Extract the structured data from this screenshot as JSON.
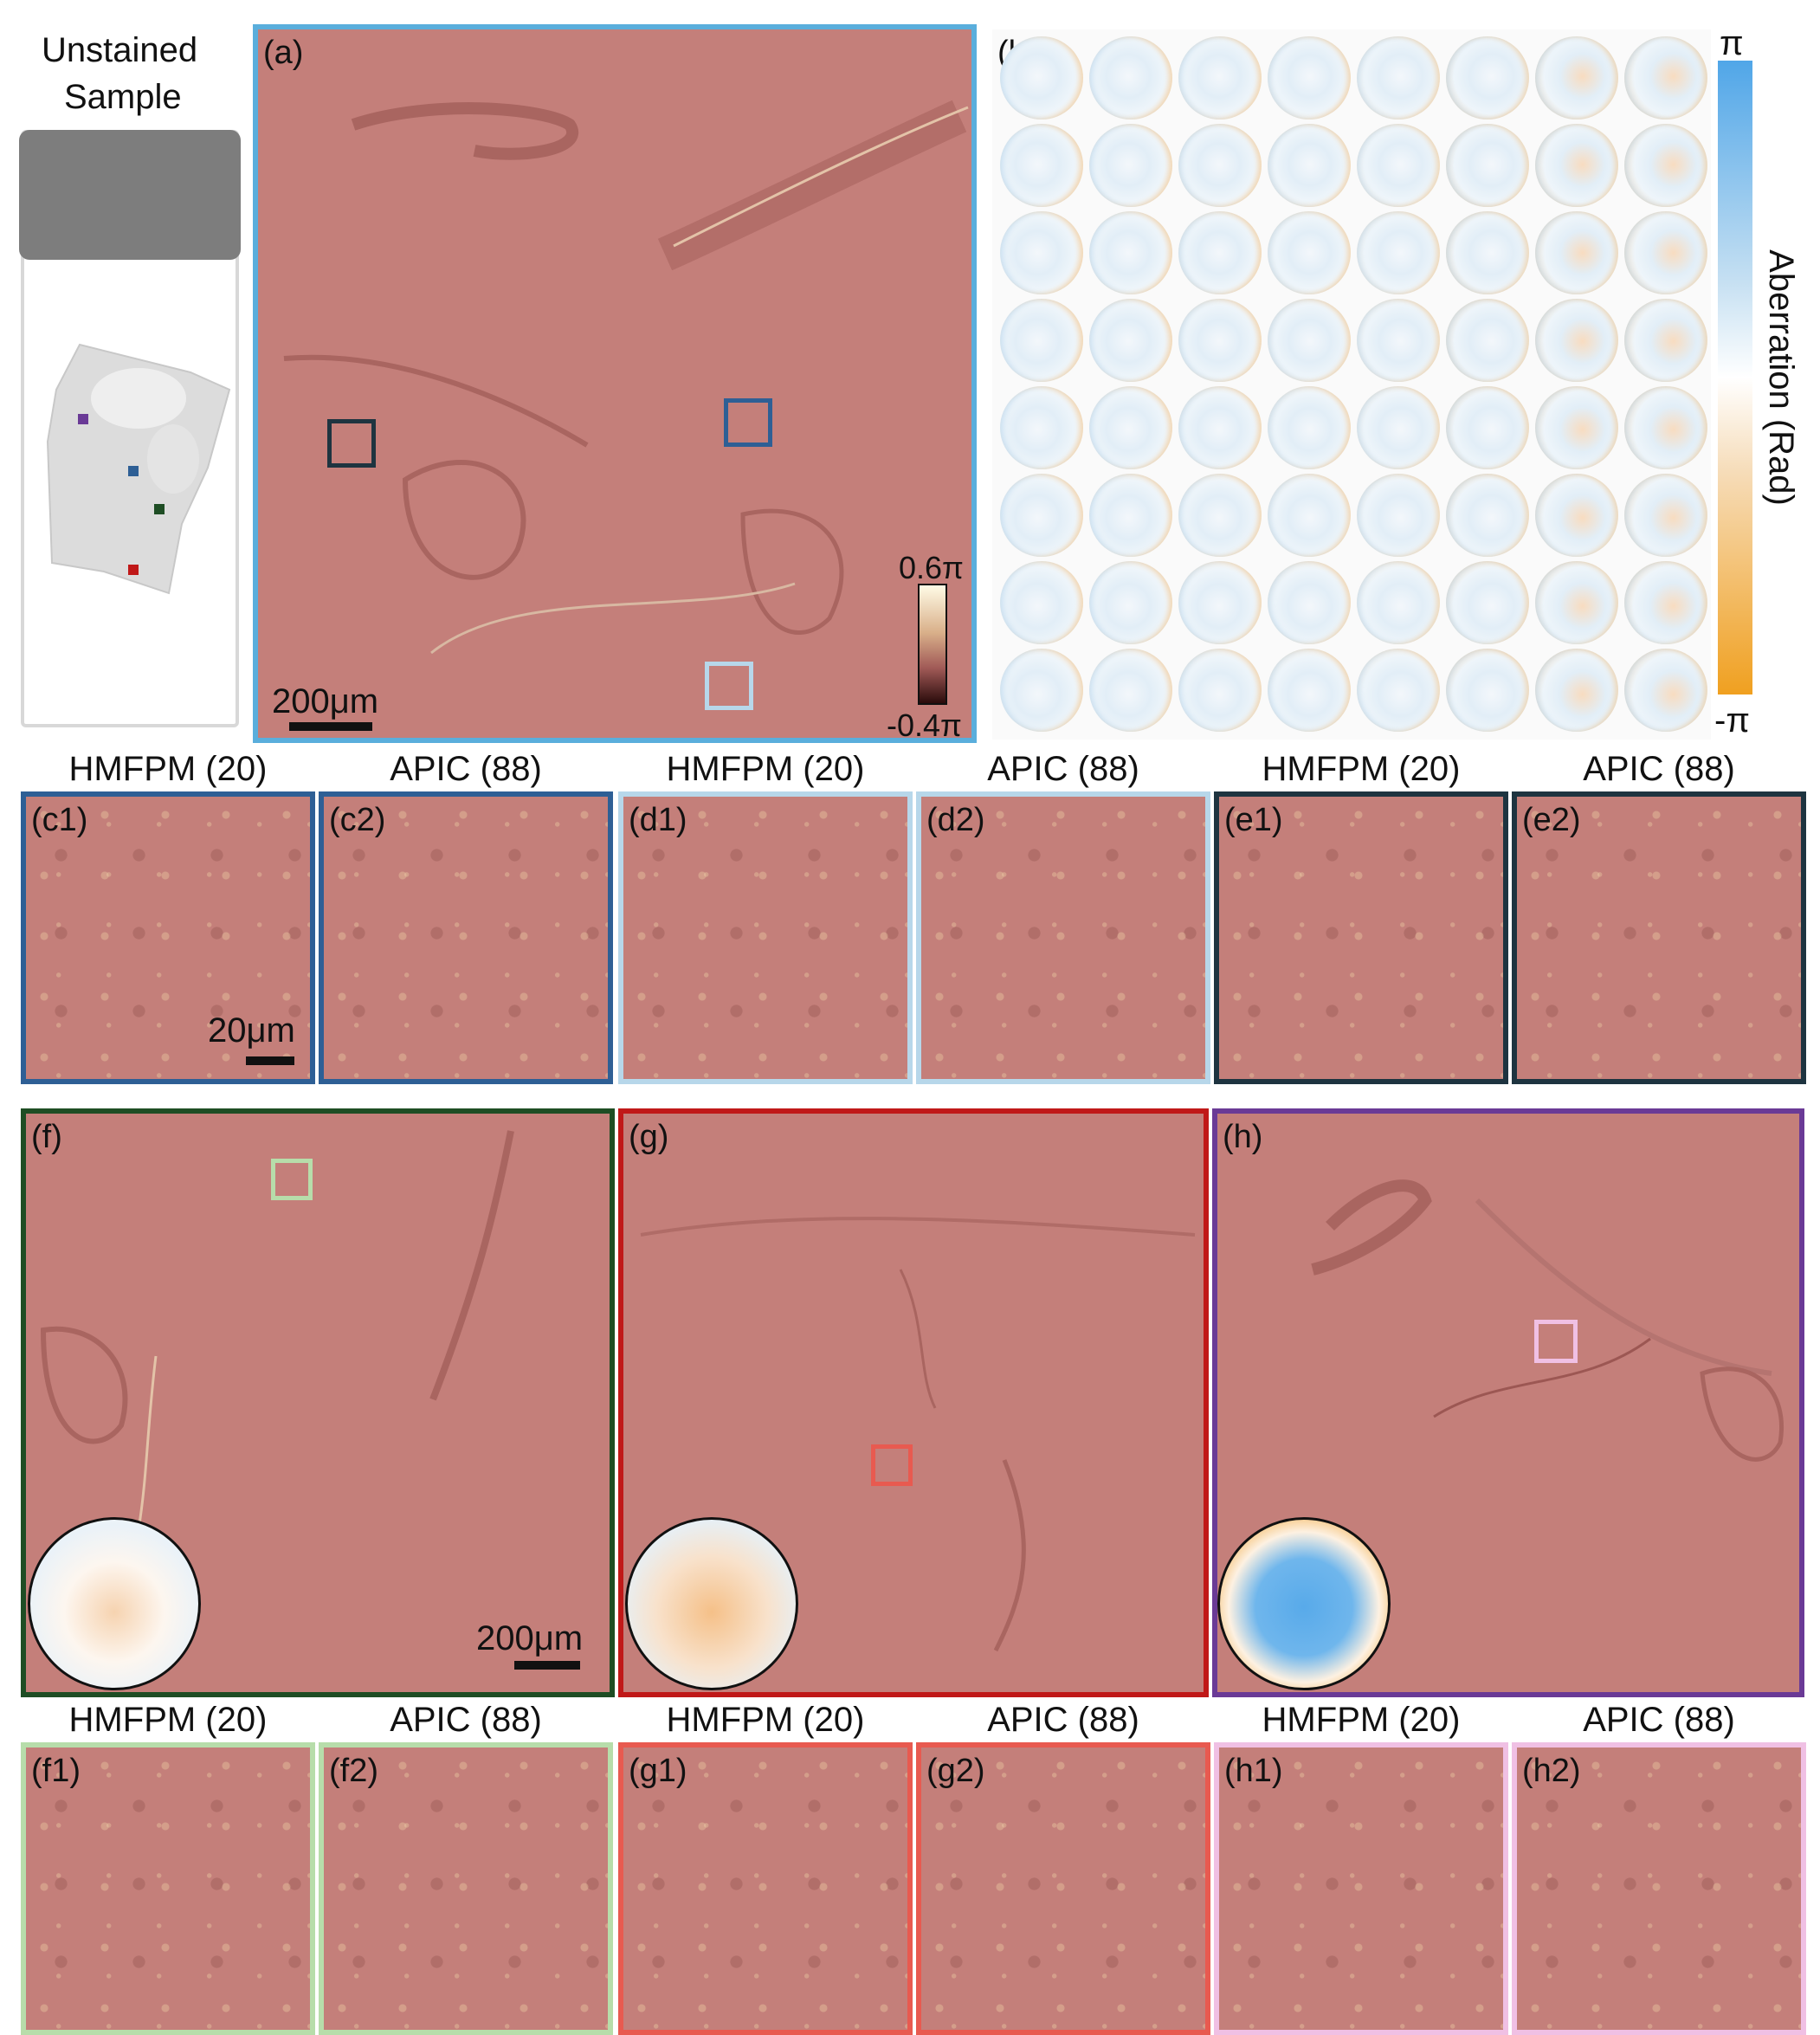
{
  "left_label": {
    "line1": "Unstained",
    "line2": "Sample"
  },
  "panel_a": {
    "label": "(a)",
    "scale": "200μm",
    "colorbar_max": "0.6π",
    "colorbar_min": "-0.4π"
  },
  "panel_b": {
    "label": "(b)",
    "cbar_top": "π",
    "cbar_bottom": "-π",
    "cbar_title": "Aberration (Rad)"
  },
  "row1_headers": [
    "HMFPM (20)",
    "APIC (88)",
    "HMFPM (20)",
    "APIC (88)",
    "HMFPM (20)",
    "APIC (88)"
  ],
  "row1_labels": [
    "(c1)",
    "(c2)",
    "(d1)",
    "(d2)",
    "(e1)",
    "(e2)"
  ],
  "row1_scale": "20μm",
  "panel_f": {
    "label": "(f)",
    "scale": "200μm"
  },
  "panel_g": {
    "label": "(g)"
  },
  "panel_h": {
    "label": "(h)"
  },
  "row2_headers": [
    "HMFPM (20)",
    "APIC (88)",
    "HMFPM (20)",
    "APIC (88)",
    "HMFPM (20)",
    "APIC (88)"
  ],
  "row2_labels": [
    "(f1)",
    "(f2)",
    "(g1)",
    "(g2)",
    "(h1)",
    "(h2)"
  ],
  "colors": {
    "dark_blue": "#2e5f95",
    "light_blue": "#b7d7ea",
    "navy": "#1e3440",
    "green": "#1e4d24",
    "light_green": "#b7ddaa",
    "red": "#c01818",
    "light_red": "#e85a50",
    "purple": "#6a3a96",
    "pink": "#f0c0e4",
    "frame_a": "#5aaedc"
  }
}
